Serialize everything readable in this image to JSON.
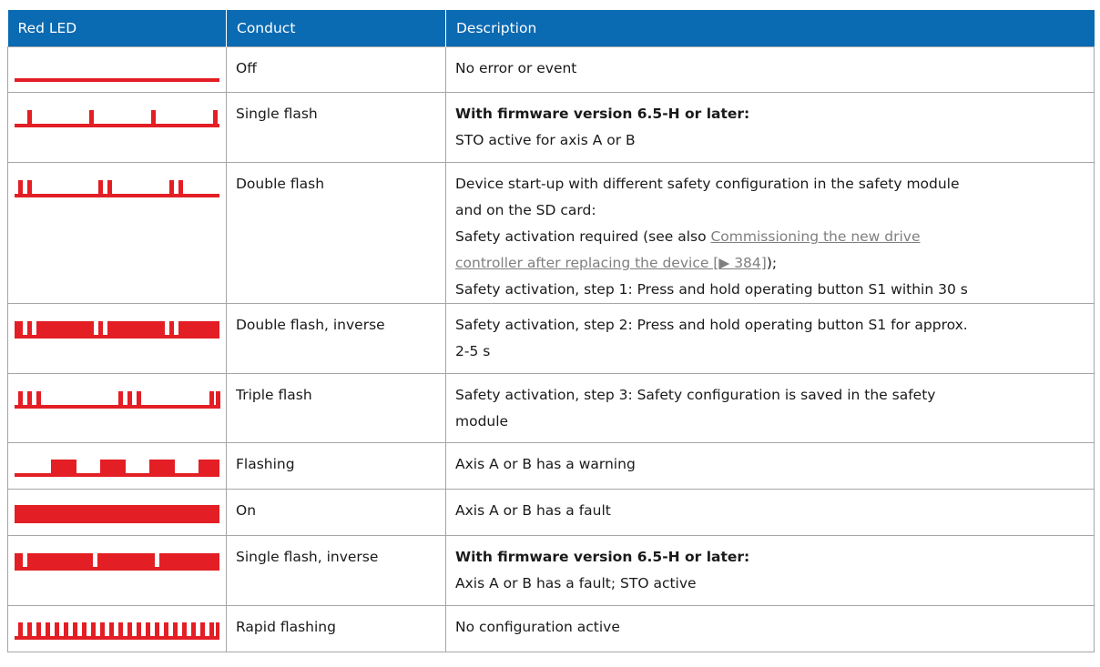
{
  "colors": {
    "header_bg": "#0a6ab2",
    "led_red": "#e31e24",
    "border": "#a6a6a6"
  },
  "table": {
    "headers": [
      "Red LED",
      "Conduct",
      "Description"
    ],
    "rows": [
      {
        "pattern_icon": "led-off-pattern-icon",
        "conduct": "Off",
        "lines": [
          {
            "text": "No error or event"
          }
        ]
      },
      {
        "pattern_icon": "led-single-flash-pattern-icon",
        "conduct": "Single flash",
        "lines": [
          {
            "text": "With firmware version 6.5-H or later:"
          },
          {
            "text": "STO active for axis A or B"
          }
        ]
      },
      {
        "pattern_icon": "led-double-flash-pattern-icon",
        "conduct": "Double flash",
        "lines": [
          {
            "text": "Device start-up with different safety configuration in the safety module"
          },
          {
            "text": "and on the SD card:"
          },
          {
            "text": "Safety activation required (see also "
          },
          {
            "link1": "Commissioning the new drive"
          },
          {
            "link2": "controller after replacing the device [▶ 384]",
            "after": ");"
          },
          {
            "text": "Safety activation, step 1: Press and hold operating button S1 within 30 s"
          }
        ]
      },
      {
        "pattern_icon": "led-double-flash-inverse-pattern-icon",
        "conduct": "Double flash, inverse",
        "lines": [
          {
            "text": "Safety activation, step 2: Press and hold operating button S1 for approx."
          },
          {
            "text": "2-5 s"
          }
        ]
      },
      {
        "pattern_icon": "led-triple-flash-pattern-icon",
        "conduct": "Triple flash",
        "lines": [
          {
            "text": "Safety activation, step 3: Safety configuration is saved in the safety"
          },
          {
            "text": "module"
          }
        ]
      },
      {
        "pattern_icon": "led-flashing-pattern-icon",
        "conduct": "Flashing",
        "lines": [
          {
            "text": "Axis A or B has a warning"
          }
        ]
      },
      {
        "pattern_icon": "led-on-pattern-icon",
        "conduct": "On",
        "lines": [
          {
            "text": "Axis A or B has a fault"
          }
        ]
      },
      {
        "pattern_icon": "led-single-flash-inverse-pattern-icon",
        "conduct": "Single flash, inverse",
        "lines": [
          {
            "text": "With firmware version 6.5-H or later:"
          },
          {
            "text": "Axis A or B has a fault; STO active"
          }
        ]
      },
      {
        "pattern_icon": "led-rapid-flashing-pattern-icon",
        "conduct": "Rapid flashing",
        "lines": [
          {
            "text": "No configuration active"
          }
        ]
      }
    ]
  }
}
